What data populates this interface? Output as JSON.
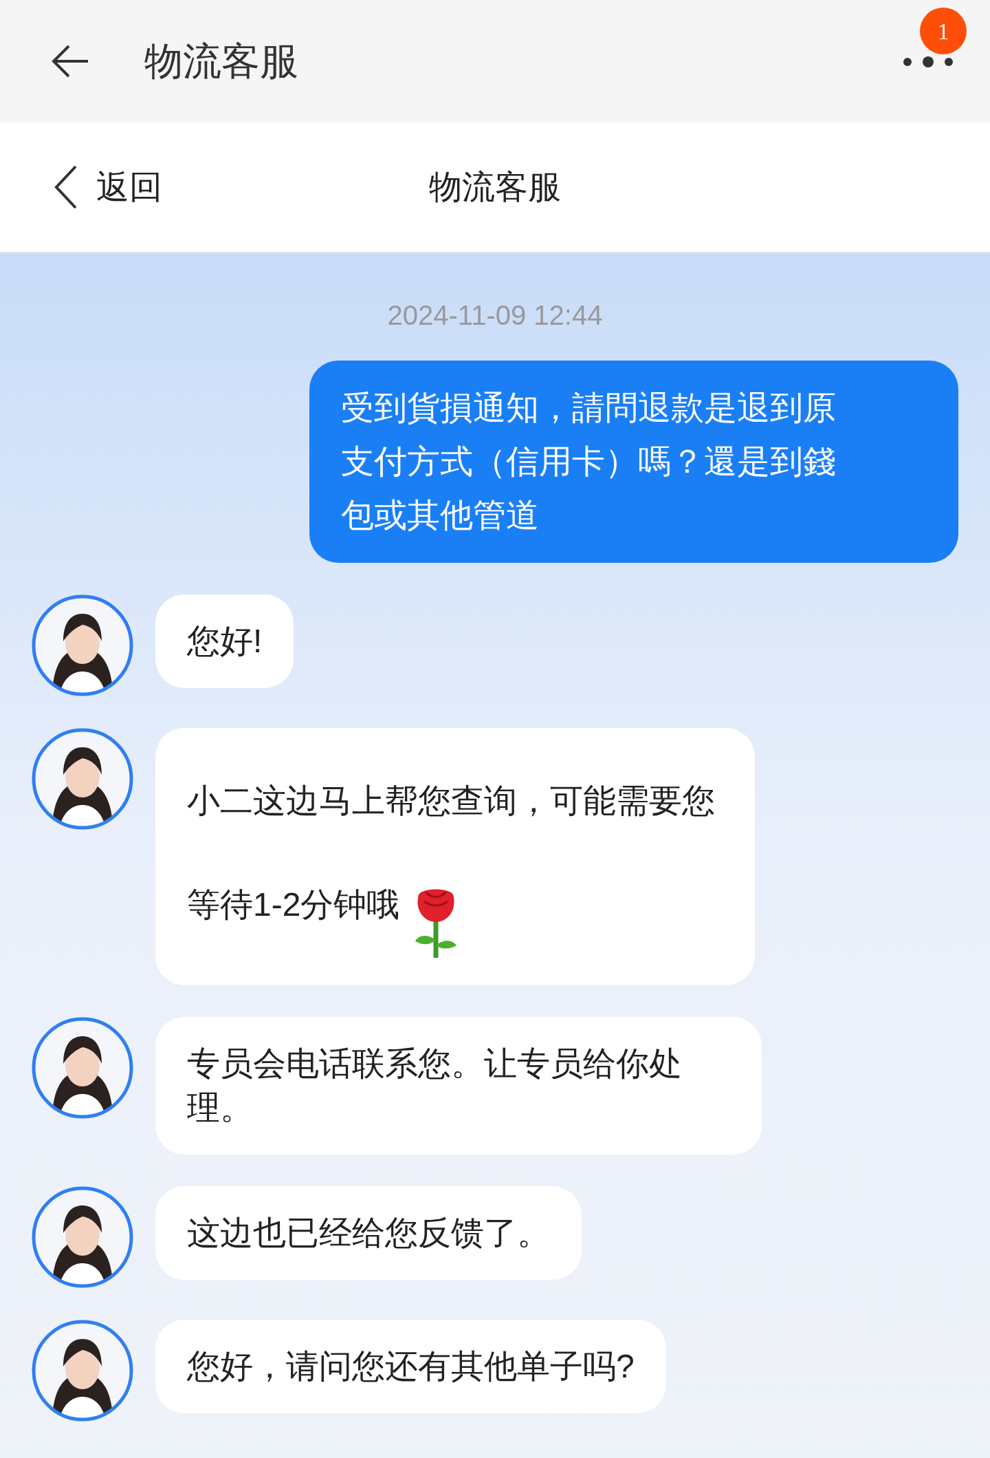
{
  "app_bar": {
    "title": "物流客服",
    "badge": "1"
  },
  "chat_header": {
    "back_label": "返回",
    "title": "物流客服"
  },
  "timestamp": "2024-11-09 12:44",
  "messages": [
    {
      "kind": "outgoing",
      "text": "受到貨損通知，請問退款是退到原支付方式（信用卡）嗎？還是到錢包或其他管道"
    },
    {
      "kind": "incoming",
      "text": "您好!"
    },
    {
      "kind": "incoming",
      "text": "小二这边马上帮您查询，可能需要您等待1-2分钟哦",
      "rose_emoji": true
    },
    {
      "kind": "incoming",
      "text": "专员会电话联系您。让专员给你处理。"
    },
    {
      "kind": "incoming",
      "text": "这边也已经给您反馈了。"
    },
    {
      "kind": "incoming",
      "text": "您好，请问您还有其他单子吗?"
    }
  ]
}
